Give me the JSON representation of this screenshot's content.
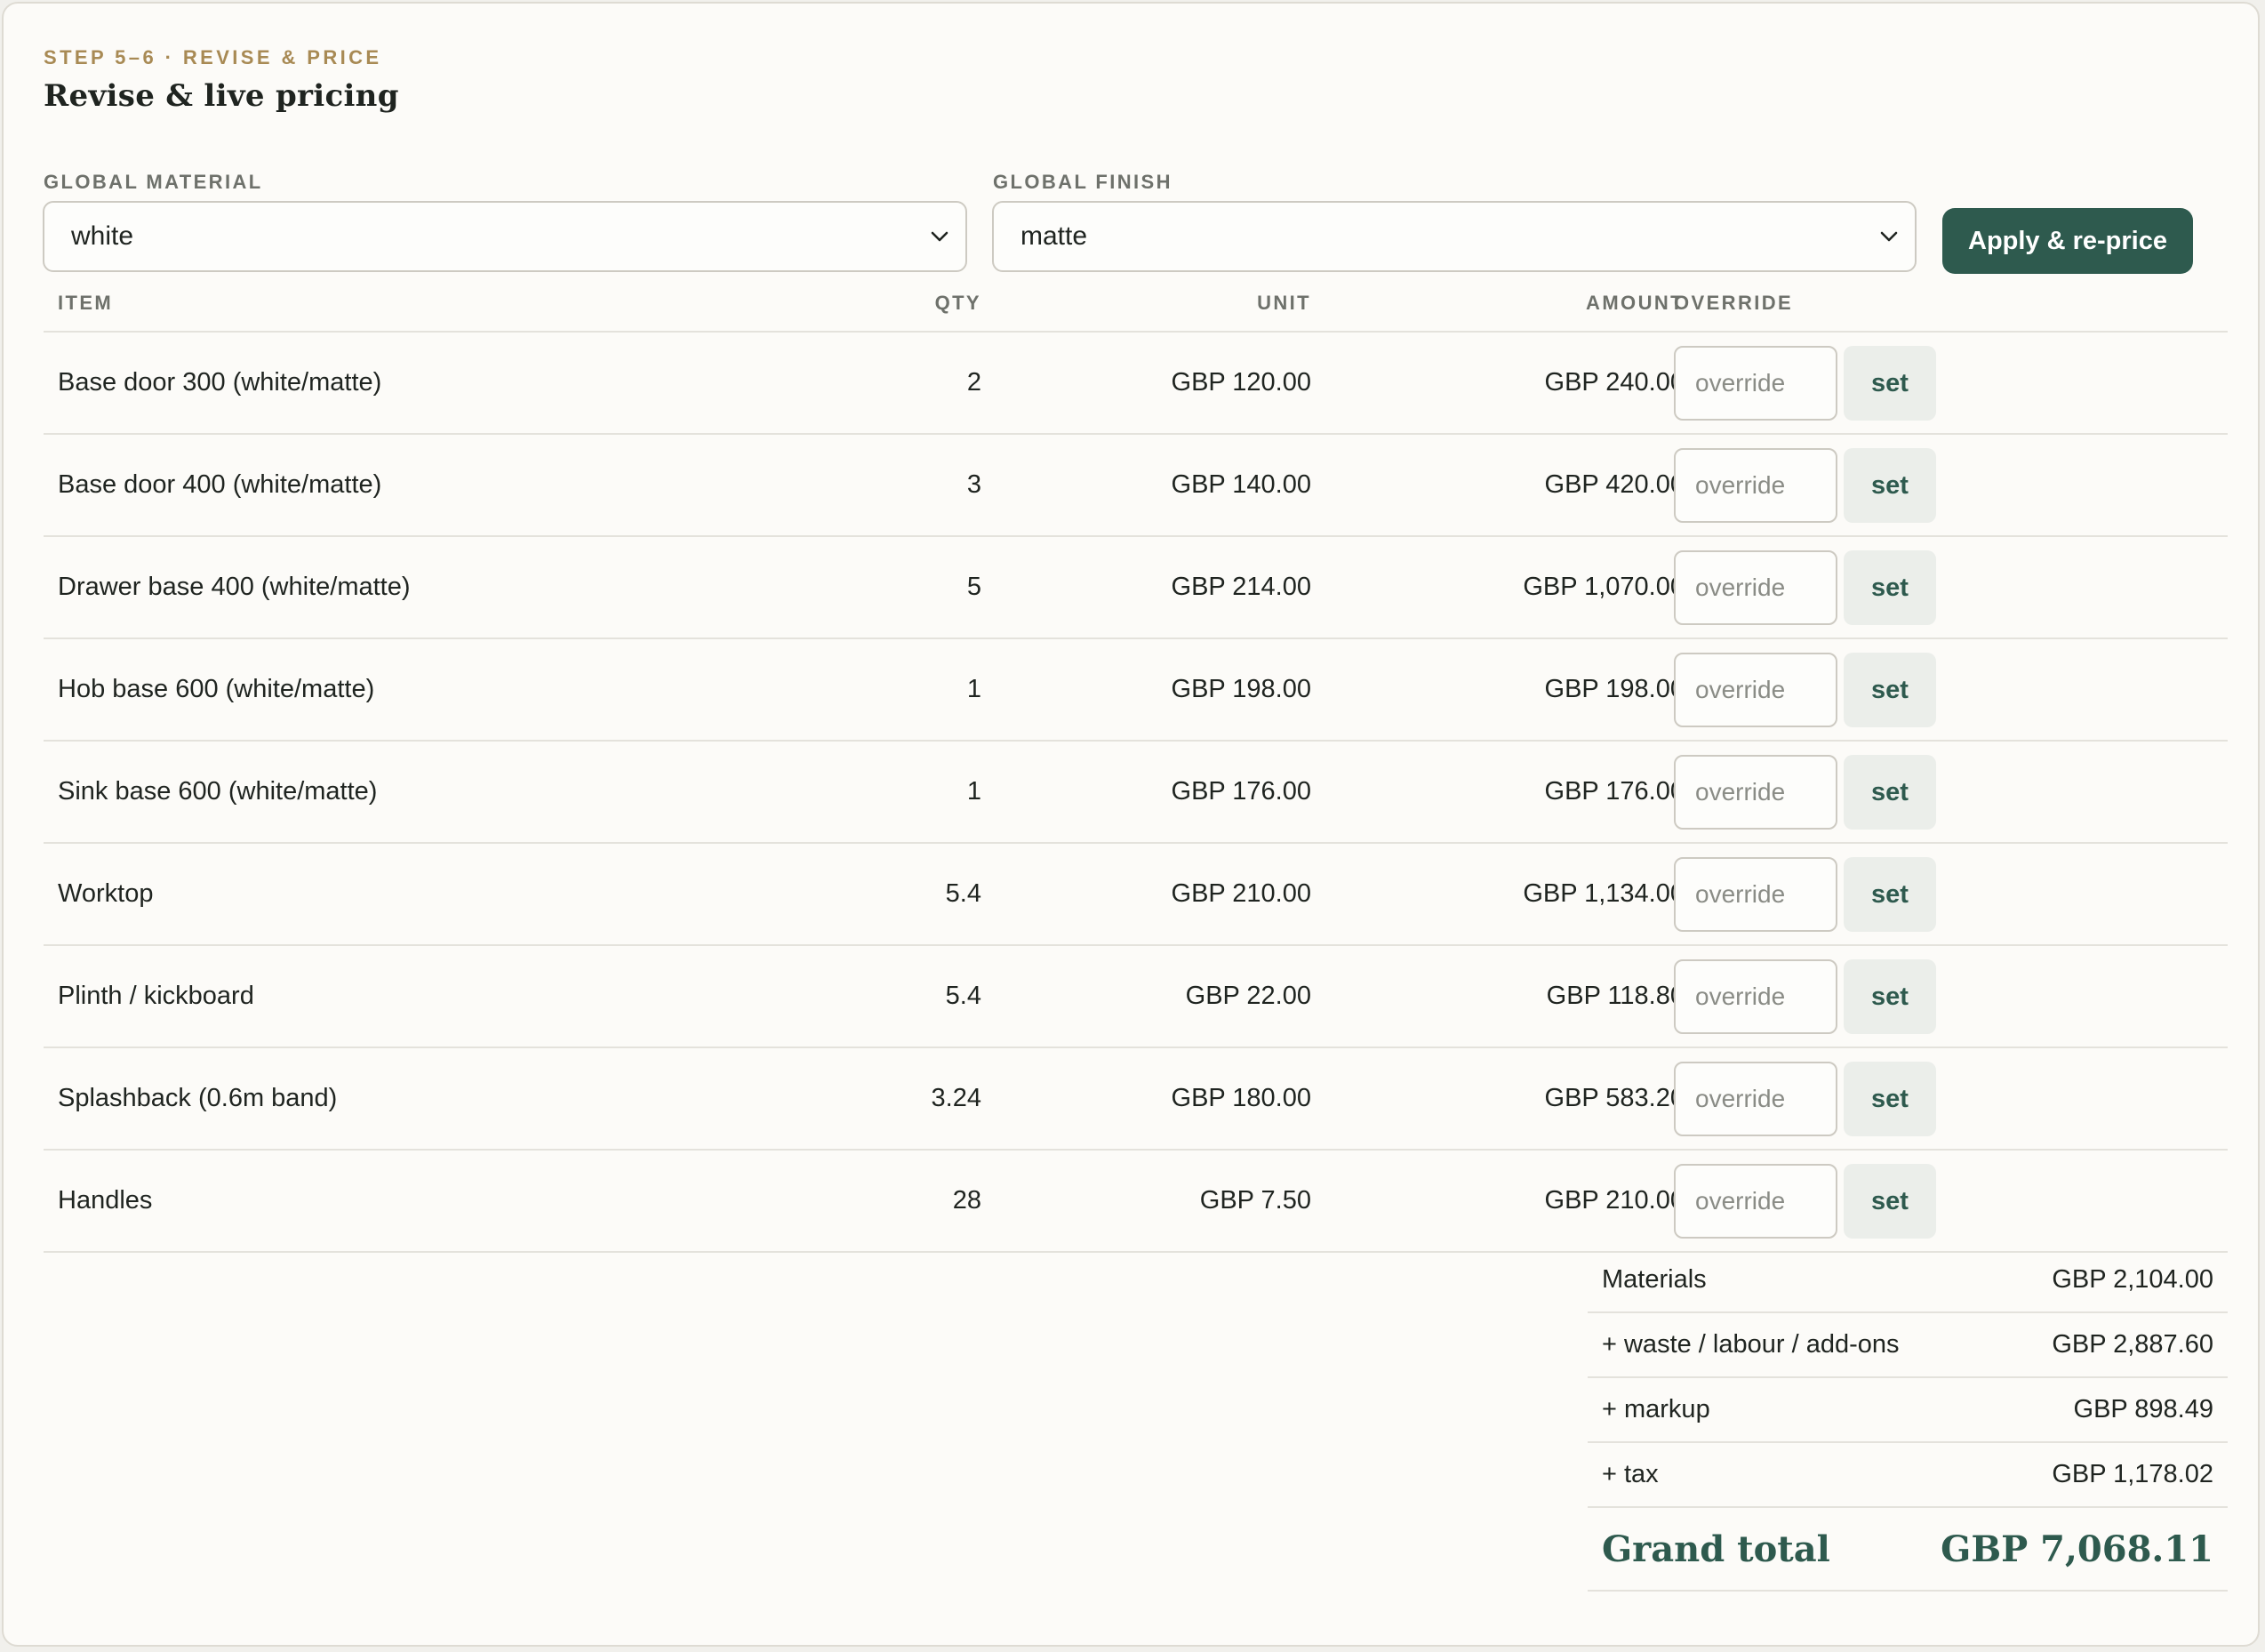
{
  "header": {
    "step": "STEP 5–6 · REVISE & PRICE",
    "title": "Revise & live pricing"
  },
  "controls": {
    "material_label": "GLOBAL MATERIAL",
    "material_value": "white",
    "finish_label": "GLOBAL FINISH",
    "finish_value": "matte",
    "apply_label": "Apply & re-price"
  },
  "table": {
    "columns": [
      "ITEM",
      "QTY",
      "UNIT",
      "AMOUNT",
      "OVERRIDE"
    ],
    "override_placeholder": "override",
    "set_label": "set",
    "rows": [
      {
        "item": "Base door 300 (white/matte)",
        "qty": "2",
        "unit": "GBP 120.00",
        "amount": "GBP 240.00"
      },
      {
        "item": "Base door 400 (white/matte)",
        "qty": "3",
        "unit": "GBP 140.00",
        "amount": "GBP 420.00"
      },
      {
        "item": "Drawer base 400 (white/matte)",
        "qty": "5",
        "unit": "GBP 214.00",
        "amount": "GBP 1,070.00"
      },
      {
        "item": "Hob base 600 (white/matte)",
        "qty": "1",
        "unit": "GBP 198.00",
        "amount": "GBP 198.00"
      },
      {
        "item": "Sink base 600 (white/matte)",
        "qty": "1",
        "unit": "GBP 176.00",
        "amount": "GBP 176.00"
      },
      {
        "item": "Worktop",
        "qty": "5.4",
        "unit": "GBP 210.00",
        "amount": "GBP 1,134.00"
      },
      {
        "item": "Plinth / kickboard",
        "qty": "5.4",
        "unit": "GBP 22.00",
        "amount": "GBP 118.80"
      },
      {
        "item": "Splashback (0.6m band)",
        "qty": "3.24",
        "unit": "GBP 180.00",
        "amount": "GBP 583.20"
      },
      {
        "item": "Handles",
        "qty": "28",
        "unit": "GBP 7.50",
        "amount": "GBP 210.00"
      }
    ]
  },
  "summary": {
    "lines": [
      {
        "label": "Materials",
        "value": "GBP 2,104.00"
      },
      {
        "label": "+ waste / labour / add-ons",
        "value": "GBP 2,887.60"
      },
      {
        "label": "+ markup",
        "value": "GBP 898.49"
      },
      {
        "label": "+ tax",
        "value": "GBP 1,178.02"
      }
    ],
    "grand_label": "Grand total",
    "grand_value": "GBP 7,068.11"
  },
  "colors": {
    "accent": "#2e5a4e",
    "step_label": "#a88a54",
    "background": "#fcfbf8"
  }
}
